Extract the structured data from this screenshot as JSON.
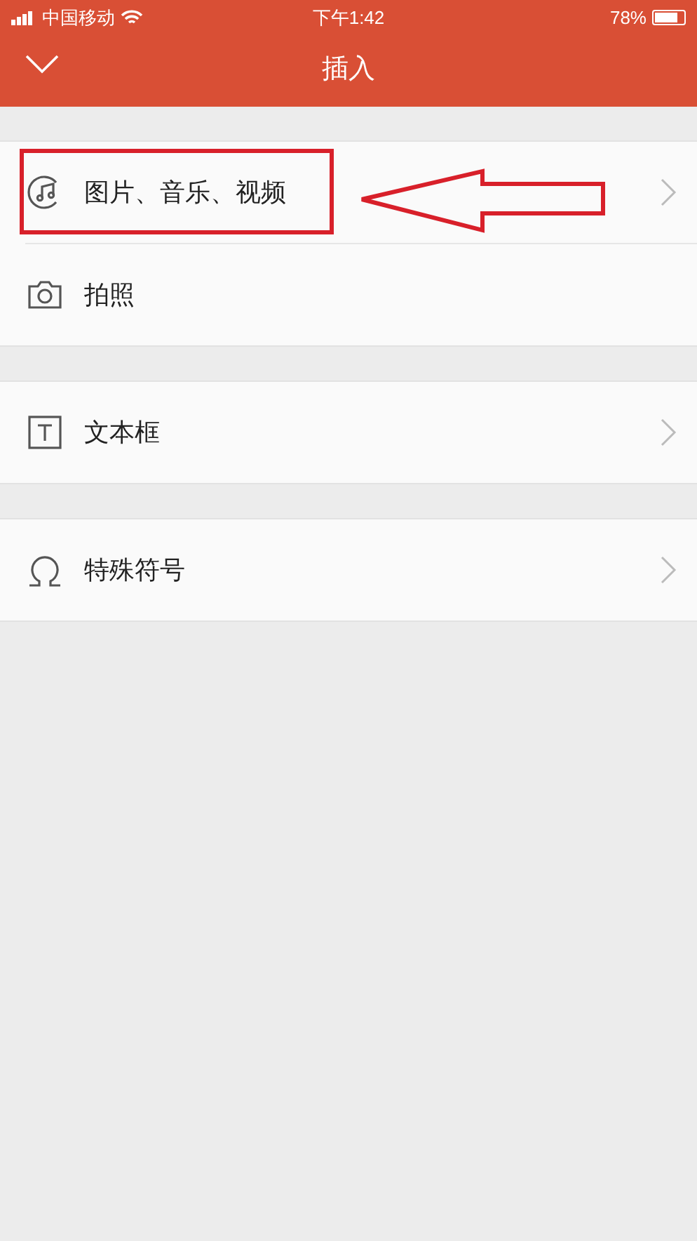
{
  "status_bar": {
    "carrier": "中国移动",
    "time": "下午1:42",
    "battery": "78%"
  },
  "header": {
    "title": "插入"
  },
  "groups": [
    {
      "items": [
        {
          "kind": "music",
          "label": "图片、音乐、视频",
          "chevron": true,
          "highlighted": true
        },
        {
          "kind": "camera",
          "label": "拍照",
          "chevron": false,
          "highlighted": false
        }
      ]
    },
    {
      "items": [
        {
          "kind": "textbox",
          "label": "文本框",
          "chevron": true,
          "highlighted": false
        }
      ]
    },
    {
      "items": [
        {
          "kind": "omega",
          "label": "特殊符号",
          "chevron": true,
          "highlighted": false
        }
      ]
    }
  ]
}
